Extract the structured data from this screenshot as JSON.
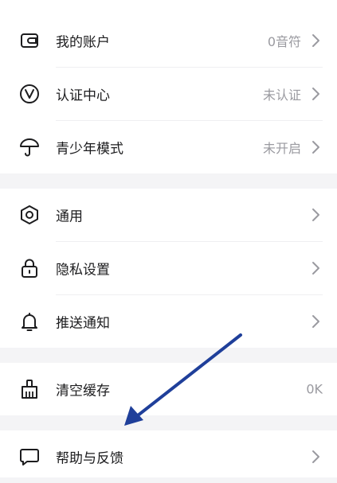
{
  "groups": [
    {
      "items": [
        {
          "label": "我的账户",
          "value": "0音符",
          "icon": "wallet-icon"
        },
        {
          "label": "认证中心",
          "value": "未认证",
          "icon": "verified-v-icon"
        },
        {
          "label": "青少年模式",
          "value": "未开启",
          "icon": "umbrella-icon"
        }
      ]
    },
    {
      "items": [
        {
          "label": "通用",
          "value": "",
          "icon": "hexagon-settings-icon"
        },
        {
          "label": "隐私设置",
          "value": "",
          "icon": "lock-icon"
        },
        {
          "label": "推送通知",
          "value": "",
          "icon": "bell-icon"
        }
      ]
    },
    {
      "items": [
        {
          "label": "清空缓存",
          "value": "0K",
          "icon": "broom-icon"
        }
      ]
    },
    {
      "items": [
        {
          "label": "帮助与反馈",
          "value": "",
          "icon": "chat-bubble-icon"
        }
      ]
    }
  ],
  "colors": {
    "annotation_arrow": "#1f3f9a",
    "text_primary": "#1c1c1e",
    "text_secondary": "#9a9aa0",
    "group_gap": "#f4f4f6"
  }
}
